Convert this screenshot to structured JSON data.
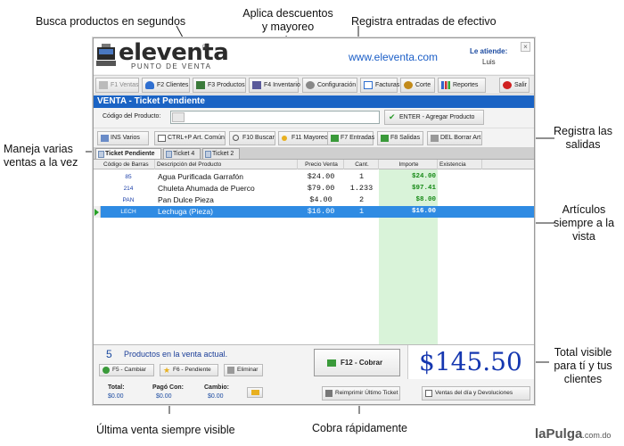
{
  "annotations": {
    "search": "Busca productos en segundos",
    "discounts": "Aplica descuentos\ny mayoreo",
    "cash_in": "Registra entradas de efectivo",
    "outputs": "Registra las\nsalidas",
    "multi": "Maneja varias\nventas a la vez",
    "articles": "Artículos\nsiempre a la\nvista",
    "total": "Total visible\npara tí y tus\nclientes",
    "last_sale": "Última venta siempre visible",
    "charge": "Cobra rápidamente"
  },
  "header": {
    "logo": "eleventa",
    "logo_sub": "PUNTO DE VENTA",
    "reg": "®",
    "site": "www.eleventa.com",
    "attends_label": "Le atiende:",
    "attends_user": "Luis",
    "close": "×"
  },
  "toolbar": [
    {
      "label": "F1 Ventas",
      "active": true,
      "color": "#888888"
    },
    {
      "label": "F2 Clientes",
      "color": "#2f6fd0"
    },
    {
      "label": "F3 Productos",
      "color": "#3a7a3a"
    },
    {
      "label": "F4 Inventario",
      "color": "#5a5a9a"
    },
    {
      "label": "Configuración",
      "color": "#777777"
    },
    {
      "label": "Facturas",
      "color": "#2f6fd0"
    },
    {
      "label": "Corte",
      "color": "#c28a1a"
    },
    {
      "label": "Reportes",
      "color": "#3366cc"
    },
    {
      "label": "Salir",
      "color": "#d02020"
    }
  ],
  "title_bar": "VENTA - Ticket Pendiente",
  "code_label": "Código del Producto:",
  "enter_button": "ENTER - Agregar Producto",
  "actions": [
    {
      "label": "INS Varios"
    },
    {
      "label": "CTRL+P Art. Común"
    },
    {
      "label": "F10 Buscar"
    },
    {
      "label": "F11 Mayoreo"
    },
    {
      "label": "F7 Entradas"
    },
    {
      "label": "F8 Salidas"
    },
    {
      "label": "DEL Borrar Art"
    }
  ],
  "tabs": [
    "Ticket Pendiente",
    "Ticket 4",
    "Ticket 2"
  ],
  "columns": [
    "Código de Barras",
    "Descripción del Producto",
    "Precio Venta",
    "Cant.",
    "Importe",
    "Existencia"
  ],
  "rows": [
    {
      "code": "85",
      "desc": "Agua Purificada Garrafón",
      "price": "$24.00",
      "qty": "1",
      "amount": "$24.00"
    },
    {
      "code": "214",
      "desc": "Chuleta Ahumada de Puerco",
      "price": "$79.00",
      "qty": "1.233",
      "amount": "$97.41"
    },
    {
      "code": "PAN",
      "desc": "Pan Dulce Pieza",
      "price": "$4.00",
      "qty": "2",
      "amount": "$8.00"
    },
    {
      "code": "LECH",
      "desc": "Lechuga (Pieza)",
      "price": "$16.00",
      "qty": "1",
      "amount": "$16.00",
      "selected": true
    }
  ],
  "summary": {
    "count": "5",
    "count_text": "Productos en la venta actual.",
    "btn_change": "F5 - Cambiar",
    "btn_pending": "F6 - Pendiente",
    "btn_delete": "Eliminar",
    "cobrar": "F12 - Cobrar",
    "total": "$145.50"
  },
  "footer": {
    "total_label": "Total:",
    "total_value": "$0.00",
    "paid_label": "Pagó Con:",
    "paid_value": "$0.00",
    "change_label": "Cambio:",
    "change_value": "$0.00",
    "reprint": "Reimprimir Último Ticket",
    "daily": "Ventas del día y Devoluciones"
  },
  "watermark": {
    "main": "laPulga",
    "sub": ".com.do"
  }
}
